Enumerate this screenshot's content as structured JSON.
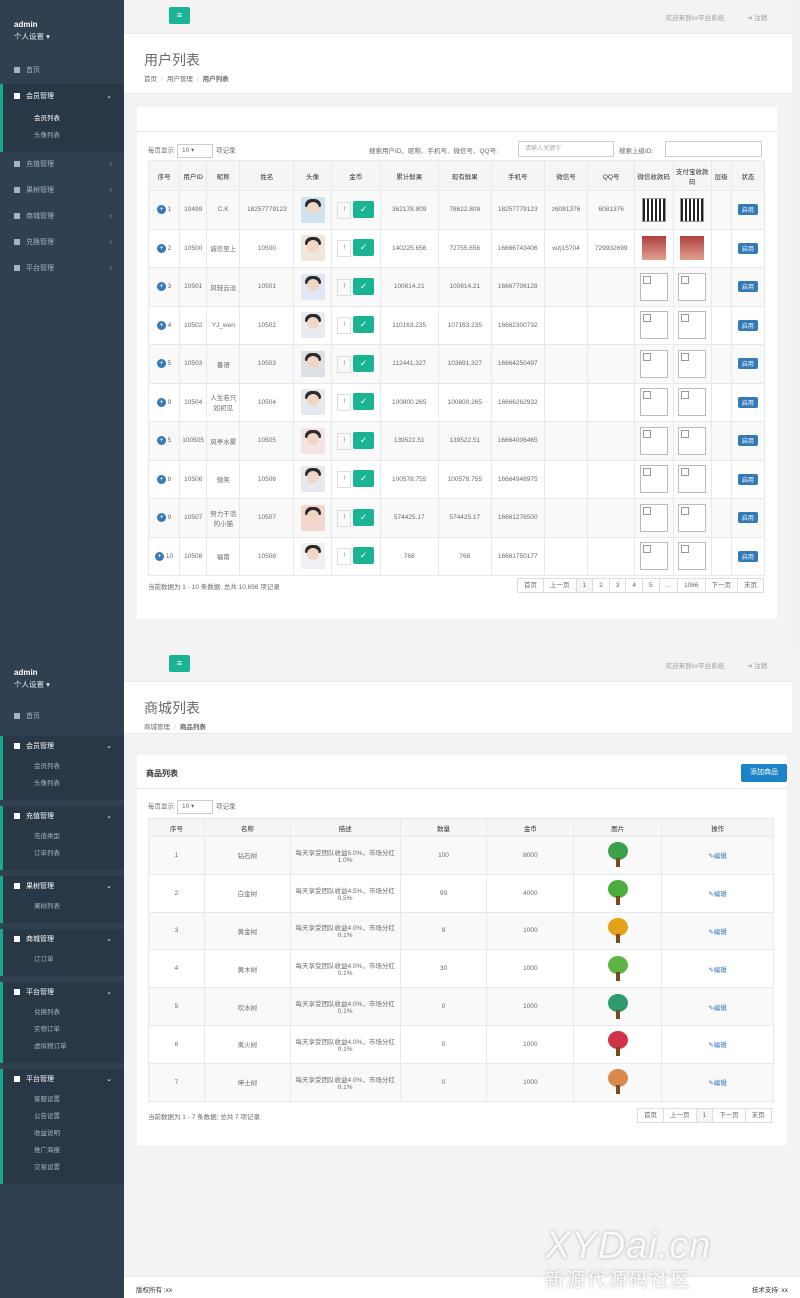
{
  "s1": {
    "sidebar": {
      "user": "admin",
      "settings": "个人设置",
      "items": [
        {
          "label": "首页"
        },
        {
          "label": "会员管理"
        },
        {
          "label": "充值管理"
        },
        {
          "label": "果树管理"
        },
        {
          "label": "商城管理"
        },
        {
          "label": "兑换管理"
        },
        {
          "label": "平台管理"
        }
      ],
      "sub": [
        "会员列表",
        "头像列表"
      ]
    },
    "topbar": {
      "welcome": "欢迎来到xx平台系统",
      "logout": "注销"
    },
    "header": {
      "title": "用户列表",
      "crumb1": "首页",
      "crumb2": "用户管理",
      "crumb3": "用户列表"
    },
    "table": {
      "length_prefix": "每页显示",
      "length_value": "10",
      "length_suffix": "项记录",
      "search_label": "搜索用户ID、昵称、手机号、微信号、QQ号:",
      "search_placeholder": "请输入关键字",
      "parent_label": "搜索上级ID:",
      "headers": [
        "序号",
        "用户ID",
        "昵称",
        "姓名",
        "头像",
        "金币",
        "累计鲜果",
        "现有鲜果",
        "手机号",
        "微信号",
        "QQ号",
        "微信收款码",
        "支付宝收款码",
        "层级",
        "状态"
      ],
      "rows": [
        {
          "no": "1",
          "uid": "10499",
          "nick": "C.K",
          "name": "18257779123",
          "gold": "",
          "total": "362178.809",
          "now": "78622.809",
          "phone": "18257779123",
          "wx": "z6081376",
          "qq": "6081376",
          "btn": "启用"
        },
        {
          "no": "2",
          "uid": "10500",
          "nick": "诚信至上",
          "name": "10500",
          "gold": "",
          "total": "140225.656",
          "now": "72755.656",
          "phone": "16666743406",
          "wx": "wzj15704",
          "qq": "729932699",
          "btn": "启用"
        },
        {
          "no": "3",
          "uid": "10501",
          "nick": "风轻云淡",
          "name": "10501",
          "gold": "",
          "total": "100814.21",
          "now": "100814.21",
          "phone": "16667706128",
          "wx": "",
          "qq": "",
          "btn": "启用"
        },
        {
          "no": "4",
          "uid": "10502",
          "nick": "YJ_wen",
          "name": "10502",
          "gold": "",
          "total": "110163.235",
          "now": "107163.235",
          "phone": "16662300732",
          "wx": "",
          "qq": "",
          "btn": "启用"
        },
        {
          "no": "5",
          "uid": "10503",
          "nick": "番语",
          "name": "10503",
          "gold": "",
          "total": "112441.327",
          "now": "103691.327",
          "phone": "16664250497",
          "wx": "",
          "qq": "",
          "btn": "启用"
        },
        {
          "no": "9",
          "uid": "10504",
          "nick": "人生若只如初见",
          "name": "10504",
          "gold": "",
          "total": "100800.265",
          "now": "100800.265",
          "phone": "16666262932",
          "wx": "",
          "qq": "",
          "btn": "启用"
        },
        {
          "no": "5",
          "uid": "100505",
          "nick": "风亭水雾",
          "name": "10505",
          "gold": "",
          "total": "139522.51",
          "now": "139522.51",
          "phone": "16664006465",
          "wx": "",
          "qq": "",
          "btn": "启用"
        },
        {
          "no": "8",
          "uid": "10506",
          "nick": "微笑",
          "name": "10506",
          "gold": "",
          "total": "100578.755",
          "now": "100578.755",
          "phone": "16664948975",
          "wx": "",
          "qq": "",
          "btn": "启用"
        },
        {
          "no": "9",
          "uid": "10507",
          "nick": "努力干活的小猫",
          "name": "10507",
          "gold": "",
          "total": "574425.17",
          "now": "574425.17",
          "phone": "16661276500",
          "wx": "",
          "qq": "",
          "btn": "启用"
        },
        {
          "no": "10",
          "uid": "10508",
          "nick": "福南",
          "name": "10508",
          "gold": "",
          "total": "768",
          "now": "768",
          "phone": "16661750177",
          "wx": "",
          "qq": "",
          "btn": "启用"
        }
      ],
      "info": "当前数据为 1 - 10 条数据; 总共 10,656 项记录",
      "pager": [
        "首页",
        "上一页",
        "1",
        "2",
        "3",
        "4",
        "5",
        "...",
        "1066",
        "下一页",
        "末页"
      ]
    }
  },
  "s2": {
    "sidebar": {
      "user": "admin",
      "settings": "个人设置",
      "home": "首页",
      "groups": [
        {
          "label": "会员管理",
          "subs": [
            "会员列表",
            "头像列表"
          ]
        },
        {
          "label": "充值管理",
          "subs": [
            "充值类型",
            "订单列表"
          ]
        },
        {
          "label": "果树管理",
          "subs": [
            "果树列表"
          ]
        },
        {
          "label": "商城管理",
          "subs": [
            "订订单"
          ]
        },
        {
          "label": "平台管理",
          "subs": [
            "兑换列表",
            "实物订单",
            "虚拟物订单"
          ]
        },
        {
          "label": "平台管理",
          "subs": [
            "客服设置",
            "公告设置",
            "收益说明",
            "推广海报",
            "交易设置"
          ]
        }
      ]
    },
    "topbar": {
      "welcome": "欢迎来到xx平台系统",
      "logout": "注销"
    },
    "header": {
      "title": "商城列表",
      "crumb1": "商城管理",
      "crumb2": "商品列表"
    },
    "box_title": "商品列表",
    "add_button": "添加商品",
    "table": {
      "length_prefix": "每页显示",
      "length_value": "10",
      "length_suffix": "项记录",
      "headers": [
        "序号",
        "名称",
        "描述",
        "数量",
        "金币",
        "图片",
        "操作"
      ],
      "rows": [
        {
          "no": "1",
          "name": "钻石树",
          "desc": "每天享受团队收益5.0%，市场分红1.0%",
          "qty": "100",
          "gold": "8000",
          "color": "#3aa14a",
          "op": "编辑"
        },
        {
          "no": "2",
          "name": "白金树",
          "desc": "每天享受团队收益4.5%，市场分红0.5%",
          "qty": "99",
          "gold": "4000",
          "color": "#4cae3c",
          "op": "编辑"
        },
        {
          "no": "3",
          "name": "黄金树",
          "desc": "每天享受团队收益4.0%，市场分红0.1%",
          "qty": "9",
          "gold": "1000",
          "color": "#e3a21a",
          "op": "编辑"
        },
        {
          "no": "4",
          "name": "黄木树",
          "desc": "每天享受团队收益4.0%，市场分红0.1%",
          "qty": "30",
          "gold": "1000",
          "color": "#5fb342",
          "op": "编辑"
        },
        {
          "no": "5",
          "name": "坎水树",
          "desc": "每天享受团队收益4.0%，市场分红0.1%",
          "qty": "0",
          "gold": "1000",
          "color": "#2f9a6e",
          "op": "编辑"
        },
        {
          "no": "6",
          "name": "离火树",
          "desc": "每天享受团队收益4.0%，市场分红0.1%",
          "qty": "0",
          "gold": "1000",
          "color": "#d0334a",
          "op": "编辑"
        },
        {
          "no": "7",
          "name": "坤土树",
          "desc": "每天享受团队收益4.0%，市场分红0.1%",
          "qty": "0",
          "gold": "1000",
          "color": "#d98a4a",
          "op": "编辑"
        }
      ],
      "info": "当前数据为 1 - 7 条数据; 总共 7 项记录",
      "pager": [
        "首页",
        "上一页",
        "1",
        "下一页",
        "末页"
      ]
    },
    "footer": {
      "left": "版权所有 :xx",
      "right": "技术支持: xx"
    }
  },
  "watermark": {
    "line1": "XYDai.cn",
    "line2": "新源代源码社区"
  }
}
